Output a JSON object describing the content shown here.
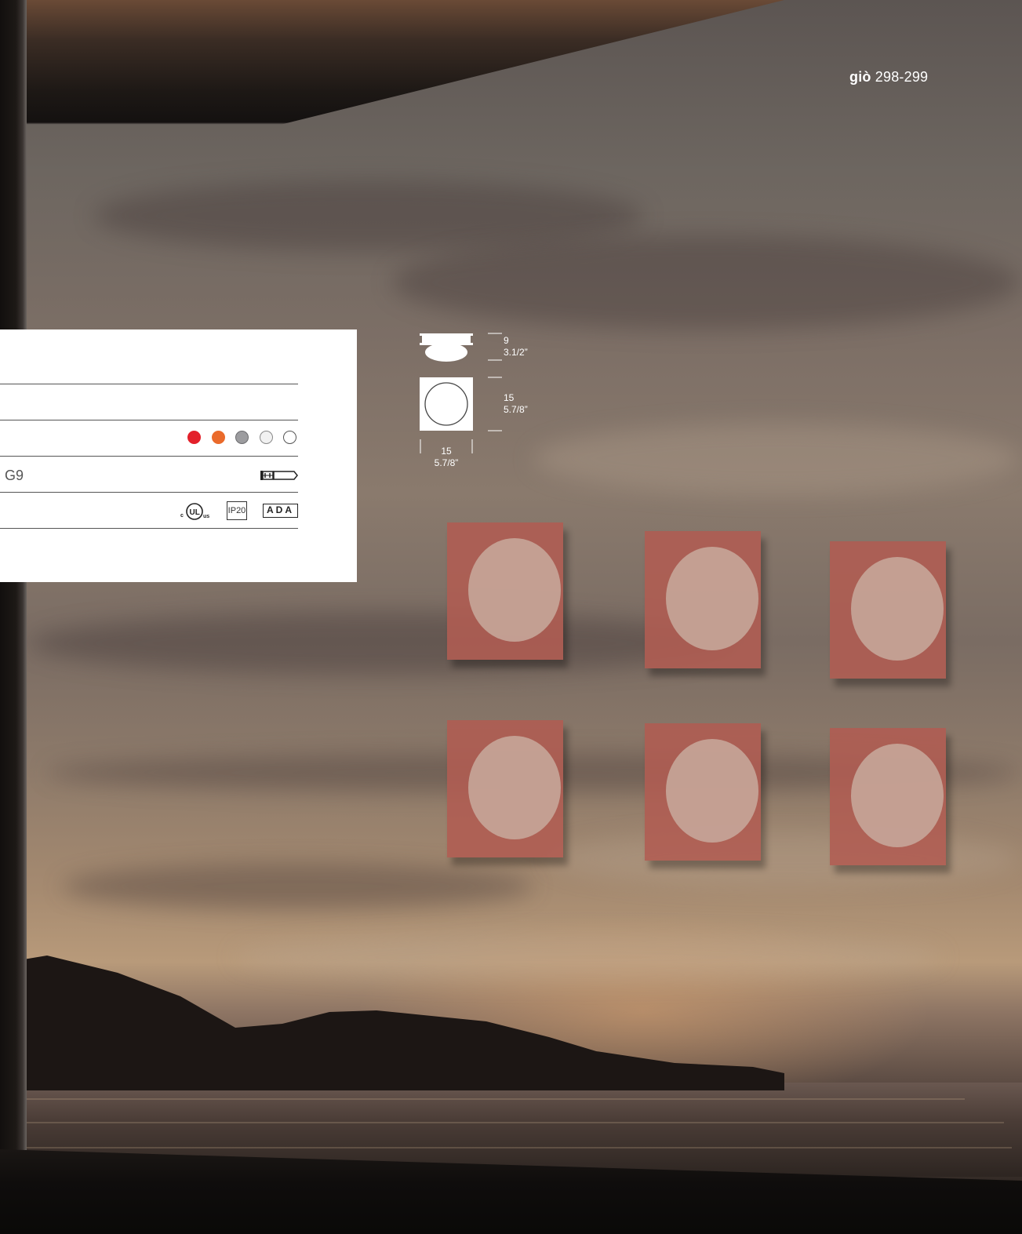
{
  "page_reference": {
    "name": "giò",
    "pages": "298-299"
  },
  "spec_table": {
    "lamp_base": "G9",
    "finish_swatches": [
      {
        "name": "red",
        "color": "#e3202a",
        "border": "#e3202a"
      },
      {
        "name": "orange",
        "color": "#ea6a2b",
        "border": "#ea6a2b"
      },
      {
        "name": "grey",
        "color": "#9c9c9f",
        "border": "#6c6c6f"
      },
      {
        "name": "light-grey",
        "color": "#f1f1f1",
        "border": "#888888"
      },
      {
        "name": "white",
        "color": "#ffffff",
        "border": "#555555"
      }
    ],
    "certifications": {
      "ul": "UL",
      "ul_left": "c",
      "ul_right": "us",
      "ip": "IP20",
      "ada": "ADA"
    }
  },
  "dimensions": {
    "height_cm": "9",
    "height_in": "3.1/2”",
    "depth_cm": "15",
    "depth_in": "5.7/8”",
    "width_cm": "15",
    "width_in": "5.7/8”"
  },
  "colors": {
    "fixture_red": "#b05c52",
    "panel_bg": "#ffffff",
    "text_white": "#ffffff"
  }
}
